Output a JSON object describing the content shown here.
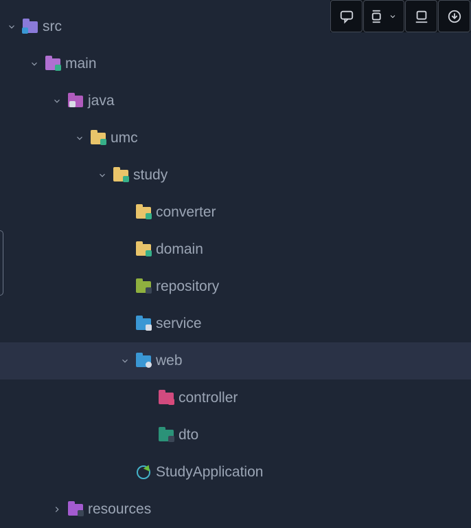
{
  "toolbar": {
    "buttons": [
      "comment",
      "layout-dropdown",
      "dock",
      "download"
    ]
  },
  "tree": {
    "src": {
      "label": "src",
      "main": {
        "label": "main",
        "java": {
          "label": "java",
          "umc": {
            "label": "umc",
            "study": {
              "label": "study",
              "converter": {
                "label": "converter"
              },
              "domain": {
                "label": "domain"
              },
              "repository": {
                "label": "repository"
              },
              "service": {
                "label": "service"
              },
              "web": {
                "label": "web",
                "controller": {
                  "label": "controller"
                },
                "dto": {
                  "label": "dto"
                }
              },
              "studyApplication": {
                "label": "StudyApplication"
              }
            }
          }
        },
        "resources": {
          "label": "resources"
        }
      }
    }
  }
}
